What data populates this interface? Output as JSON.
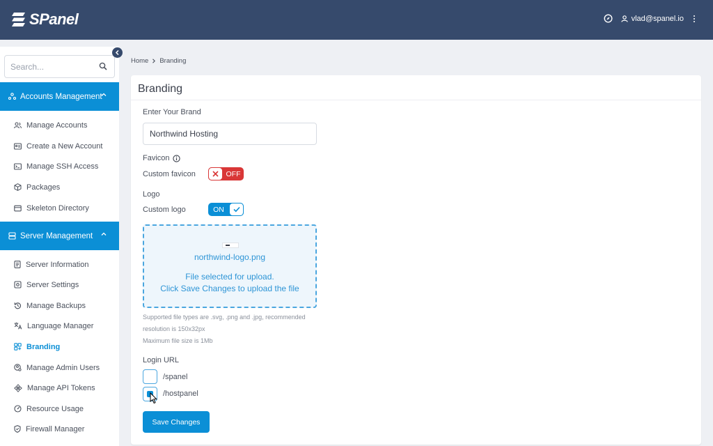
{
  "header": {
    "logo_text": "SPanel",
    "user_email": "vlad@spanel.io"
  },
  "sidebar": {
    "search_placeholder": "Search...",
    "sections": [
      {
        "title": "Accounts Management",
        "items": [
          {
            "label": "Manage Accounts",
            "icon": "users-icon"
          },
          {
            "label": "Create a New Account",
            "icon": "id-card-icon"
          },
          {
            "label": "Manage SSH Access",
            "icon": "terminal-icon"
          },
          {
            "label": "Packages",
            "icon": "package-icon"
          },
          {
            "label": "Skeleton Directory",
            "icon": "folder-icon"
          }
        ]
      },
      {
        "title": "Server Management",
        "items": [
          {
            "label": "Server Information",
            "icon": "document-icon"
          },
          {
            "label": "Server Settings",
            "icon": "settings-icon"
          },
          {
            "label": "Manage Backups",
            "icon": "backup-icon"
          },
          {
            "label": "Language Manager",
            "icon": "translate-icon"
          },
          {
            "label": "Branding",
            "icon": "branding-icon",
            "active": true
          },
          {
            "label": "Manage Admin Users",
            "icon": "admin-user-icon"
          },
          {
            "label": "Manage API Tokens",
            "icon": "api-token-icon"
          },
          {
            "label": "Resource Usage",
            "icon": "gauge-icon"
          },
          {
            "label": "Firewall Manager",
            "icon": "shield-icon"
          }
        ]
      }
    ]
  },
  "breadcrumb": {
    "home": "Home",
    "current": "Branding"
  },
  "branding": {
    "title": "Branding",
    "brand_label": "Enter Your Brand",
    "brand_value": "Northwind Hosting",
    "favicon_label": "Favicon",
    "custom_favicon_label": "Custom favicon",
    "favicon_toggle": "OFF",
    "logo_label": "Logo",
    "custom_logo_label": "Custom logo",
    "logo_toggle": "ON",
    "upload": {
      "file_name": "northwind-logo.png",
      "message_line1": "File selected for upload.",
      "message_line2": "Click Save Changes to upload the file"
    },
    "hint_line1": "Supported file types are .svg, .png and .jpg, recommended",
    "hint_line2": "resolution is 150x32px",
    "hint_line3": "Maximum file size is 1Mb",
    "login_url_label": "Login URL",
    "login_urls": [
      {
        "label": "/spanel",
        "checked": false
      },
      {
        "label": "/hostpanel",
        "checked": true
      }
    ],
    "save_label": "Save Changes"
  },
  "colors": {
    "header_bg": "#364a6c",
    "accent": "#0b8fd6",
    "off_red": "#d93737"
  }
}
